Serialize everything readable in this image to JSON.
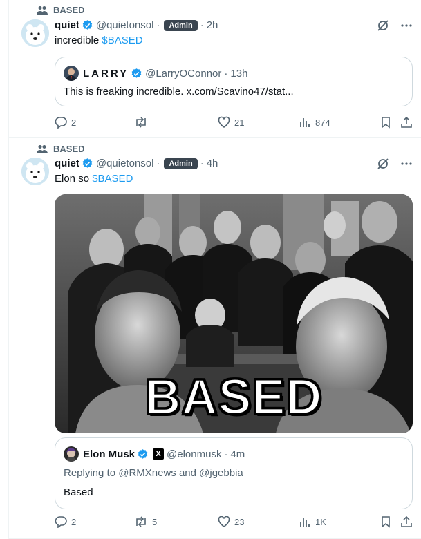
{
  "colors": {
    "accent": "#1d9bf0",
    "muted": "#536471",
    "text": "#0f1419",
    "admin_bg": "#3a4550"
  },
  "tweets": [
    {
      "community": "BASED",
      "author": {
        "name": "quiet",
        "handle": "@quietonsol",
        "badge": "Admin",
        "time": "2h"
      },
      "text_prefix": "incredible ",
      "cashtag": "$BASED",
      "quote": {
        "name": "LARRY",
        "handle": "@LarryOConnor",
        "time": "13h",
        "text": "This is freaking incredible. x.com/Scavino47/stat..."
      },
      "stats": {
        "replies": "2",
        "reposts": "",
        "likes": "21",
        "views": "874"
      }
    },
    {
      "community": "BASED",
      "author": {
        "name": "quiet",
        "handle": "@quietonsol",
        "badge": "Admin",
        "time": "4h"
      },
      "text_prefix": "Elon so ",
      "cashtag": "$BASED",
      "image": {
        "caption": "BASED"
      },
      "quote": {
        "name": "Elon Musk",
        "x_badge": "X",
        "handle": "@elonmusk",
        "time": "4m",
        "replying": "Replying to @RMXnews and @jgebbia",
        "text": "Based"
      },
      "stats": {
        "replies": "2",
        "reposts": "5",
        "likes": "23",
        "views": "1K"
      }
    }
  ]
}
